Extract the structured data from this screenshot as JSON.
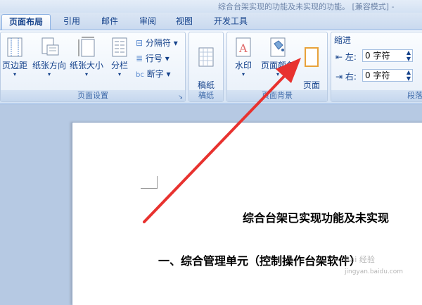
{
  "window": {
    "title": "综合台架实现的功能及未实现的功能。 [兼容模式] -"
  },
  "tabs": [
    {
      "label": "页面布局",
      "active": true
    },
    {
      "label": "引用"
    },
    {
      "label": "邮件"
    },
    {
      "label": "审阅"
    },
    {
      "label": "视图"
    },
    {
      "label": "开发工具"
    }
  ],
  "ribbon": {
    "page_setup": {
      "label": "页面设置",
      "margins": "页边距",
      "orientation": "纸张方向",
      "size": "纸张大小",
      "columns": "分栏",
      "breaks": "分隔符",
      "line_numbers": "行号",
      "hyphenation": "断字"
    },
    "draft_paper": {
      "label": "稿纸",
      "button": "稿纸\n设置"
    },
    "page_background": {
      "label": "页面背景",
      "watermark": "水印",
      "page_color": "页面颜色",
      "page_borders": "页面\n边框"
    },
    "indent": {
      "title": "缩进",
      "left_label": "左:",
      "left_value": "0 字符",
      "right_label": "右:",
      "right_value": "0 字符"
    },
    "spacing_label": "段落"
  },
  "document": {
    "title": "综合台架已实现功能及未实现",
    "heading": "一、综合管理单元（控制操作台架软件）"
  },
  "watermark": {
    "text": "Bai 经验",
    "url": "jingyan.baidu.com"
  },
  "colors": {
    "arrow": "#e8322f",
    "ribbon_text": "#15428b"
  }
}
